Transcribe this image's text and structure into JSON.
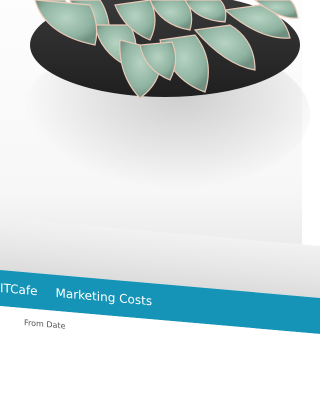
{
  "navbar": {
    "brand": "ITCafe",
    "links": [
      "Marketing Costs"
    ],
    "color": "#1594b7"
  },
  "form": {
    "from_date_label": "From Date"
  }
}
